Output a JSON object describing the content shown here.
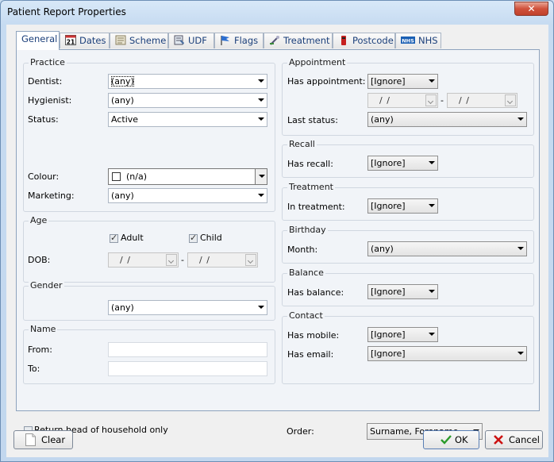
{
  "window": {
    "title": "Patient Report Properties",
    "close_glyph": "✕"
  },
  "tabs": [
    {
      "label": "General",
      "icon": "none"
    },
    {
      "label": "Dates",
      "icon": "calendar-icon",
      "icon_text": "21"
    },
    {
      "label": "Scheme",
      "icon": "scheme-icon"
    },
    {
      "label": "UDF",
      "icon": "udf-icon"
    },
    {
      "label": "Flags",
      "icon": "flag-icon"
    },
    {
      "label": "Treatment",
      "icon": "treatment-icon"
    },
    {
      "label": "Postcode",
      "icon": "postcode-icon"
    },
    {
      "label": "NHS",
      "icon": "nhs-icon",
      "icon_text": "NHS"
    }
  ],
  "practice": {
    "title": "Practice",
    "dentist_label": "Dentist:",
    "dentist_value": "(any)",
    "hygienist_label": "Hygienist:",
    "hygienist_value": "(any)",
    "status_label": "Status:",
    "status_value": "Active",
    "colour_label": "Colour:",
    "colour_value": "(n/a)",
    "marketing_label": "Marketing:",
    "marketing_value": "(any)"
  },
  "age": {
    "title": "Age",
    "adult_label": "Adult",
    "adult_checked": true,
    "child_label": "Child",
    "child_checked": true,
    "dob_label": "DOB:",
    "date_placeholder": "/ /",
    "range_sep": "-"
  },
  "gender": {
    "title": "Gender",
    "value": "(any)"
  },
  "name": {
    "title": "Name",
    "from_label": "From:",
    "to_label": "To:",
    "from_value": "",
    "to_value": ""
  },
  "household": {
    "label": "Return head of household only",
    "checked": false
  },
  "appointment": {
    "title": "Appointment",
    "has_label": "Has appointment:",
    "has_value": "[Ignore]",
    "date_placeholder": "/ /",
    "range_sep": "-",
    "last_status_label": "Last status:",
    "last_status_value": "(any)"
  },
  "recall": {
    "title": "Recall",
    "has_label": "Has recall:",
    "has_value": "[Ignore]"
  },
  "treatment": {
    "title": "Treatment",
    "in_label": "In treatment:",
    "in_value": "[Ignore]"
  },
  "birthday": {
    "title": "Birthday",
    "month_label": "Month:",
    "month_value": "(any)"
  },
  "balance": {
    "title": "Balance",
    "has_label": "Has balance:",
    "has_value": "[Ignore]"
  },
  "contact": {
    "title": "Contact",
    "mobile_label": "Has mobile:",
    "mobile_value": "[Ignore]",
    "email_label": "Has email:",
    "email_value": "[Ignore]"
  },
  "order": {
    "label": "Order:",
    "value": "Surname, Forename"
  },
  "buttons": {
    "clear": "Clear",
    "ok": "OK",
    "cancel": "Cancel"
  },
  "colors": {
    "ok_check": "#2a9a2a",
    "cancel_x": "#cc1111",
    "tab_text": "#1b3f7a"
  }
}
